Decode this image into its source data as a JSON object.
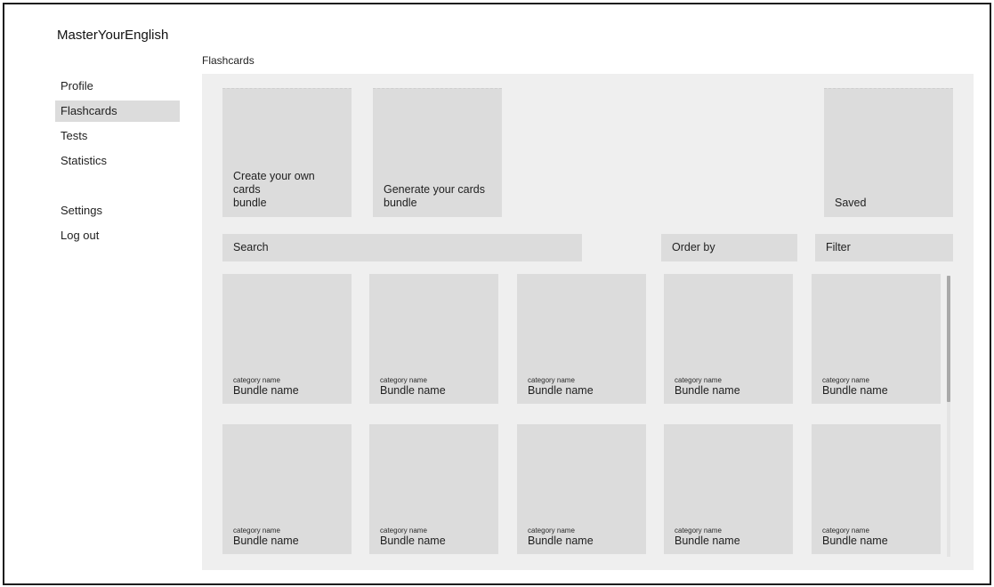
{
  "app": {
    "title": "MasterYourEnglish"
  },
  "sidebar": {
    "items": [
      {
        "label": "Profile"
      },
      {
        "label": "Flashcards",
        "active": true
      },
      {
        "label": "Tests"
      },
      {
        "label": "Statistics"
      }
    ],
    "bottom_items": [
      {
        "label": "Settings"
      },
      {
        "label": "Log out"
      }
    ]
  },
  "main": {
    "section_label": "Flashcards",
    "actions": {
      "create": "Create your own cards\nbundle",
      "generate": "Generate your cards\nbundle",
      "saved": "Saved"
    },
    "toolbar": {
      "search": "Search",
      "order_by": "Order by",
      "filter": "Filter"
    },
    "bundles": [
      {
        "category": "category name",
        "name": "Bundle name"
      },
      {
        "category": "category name",
        "name": "Bundle name"
      },
      {
        "category": "category name",
        "name": "Bundle name"
      },
      {
        "category": "category name",
        "name": "Bundle name"
      },
      {
        "category": "category name",
        "name": "Bundle name"
      },
      {
        "category": "category name",
        "name": "Bundle name"
      },
      {
        "category": "category name",
        "name": "Bundle name"
      },
      {
        "category": "category name",
        "name": "Bundle name"
      },
      {
        "category": "category name",
        "name": "Bundle name"
      },
      {
        "category": "category name",
        "name": "Bundle name"
      }
    ]
  },
  "colors": {
    "panel_bg": "#efefef",
    "card_bg": "#dcdcdc",
    "active_nav_bg": "#dcdcdc",
    "scrollbar_thumb": "#a9a9a9"
  }
}
